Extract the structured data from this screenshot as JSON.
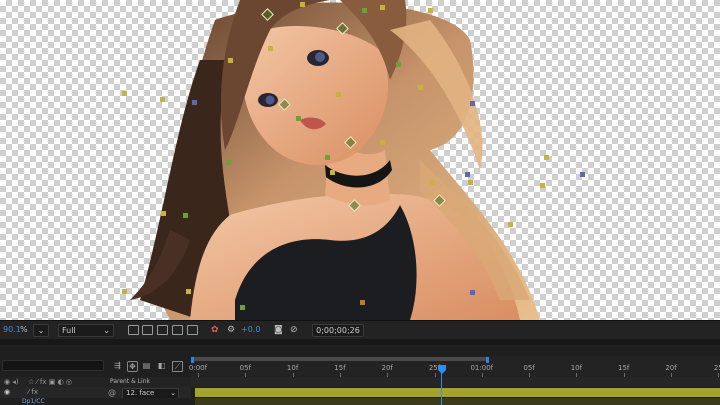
{
  "viewer": {
    "magnification_value": "90.1",
    "magnification_unit": "%",
    "resolution": "Full",
    "exposure": "+0.0",
    "timecode": "0;00;00;26",
    "icons": [
      "magnification-dropdown-icon",
      "resolution-dropdown-icon",
      "region-of-interest-icon",
      "transparency-grid-icon",
      "mask-visibility-icon",
      "guides-icon",
      "3d-view-icon",
      "color-channels-icon",
      "color-management-icon",
      "snapshot-icon",
      "show-snapshot-icon"
    ]
  },
  "timeline": {
    "ruler_labels": [
      "0:00f",
      "05f",
      "10f",
      "15f",
      "20f",
      "25f",
      "01:00f",
      "05f",
      "10f",
      "15f",
      "20f",
      "25"
    ],
    "parent_link_header": "Parent & Link",
    "layer": {
      "name": "12. face",
      "sublabel": "Dp1/CC"
    }
  },
  "colors": {
    "accent_blue": "#2f8ef4",
    "track_bar": "#a6a230"
  }
}
